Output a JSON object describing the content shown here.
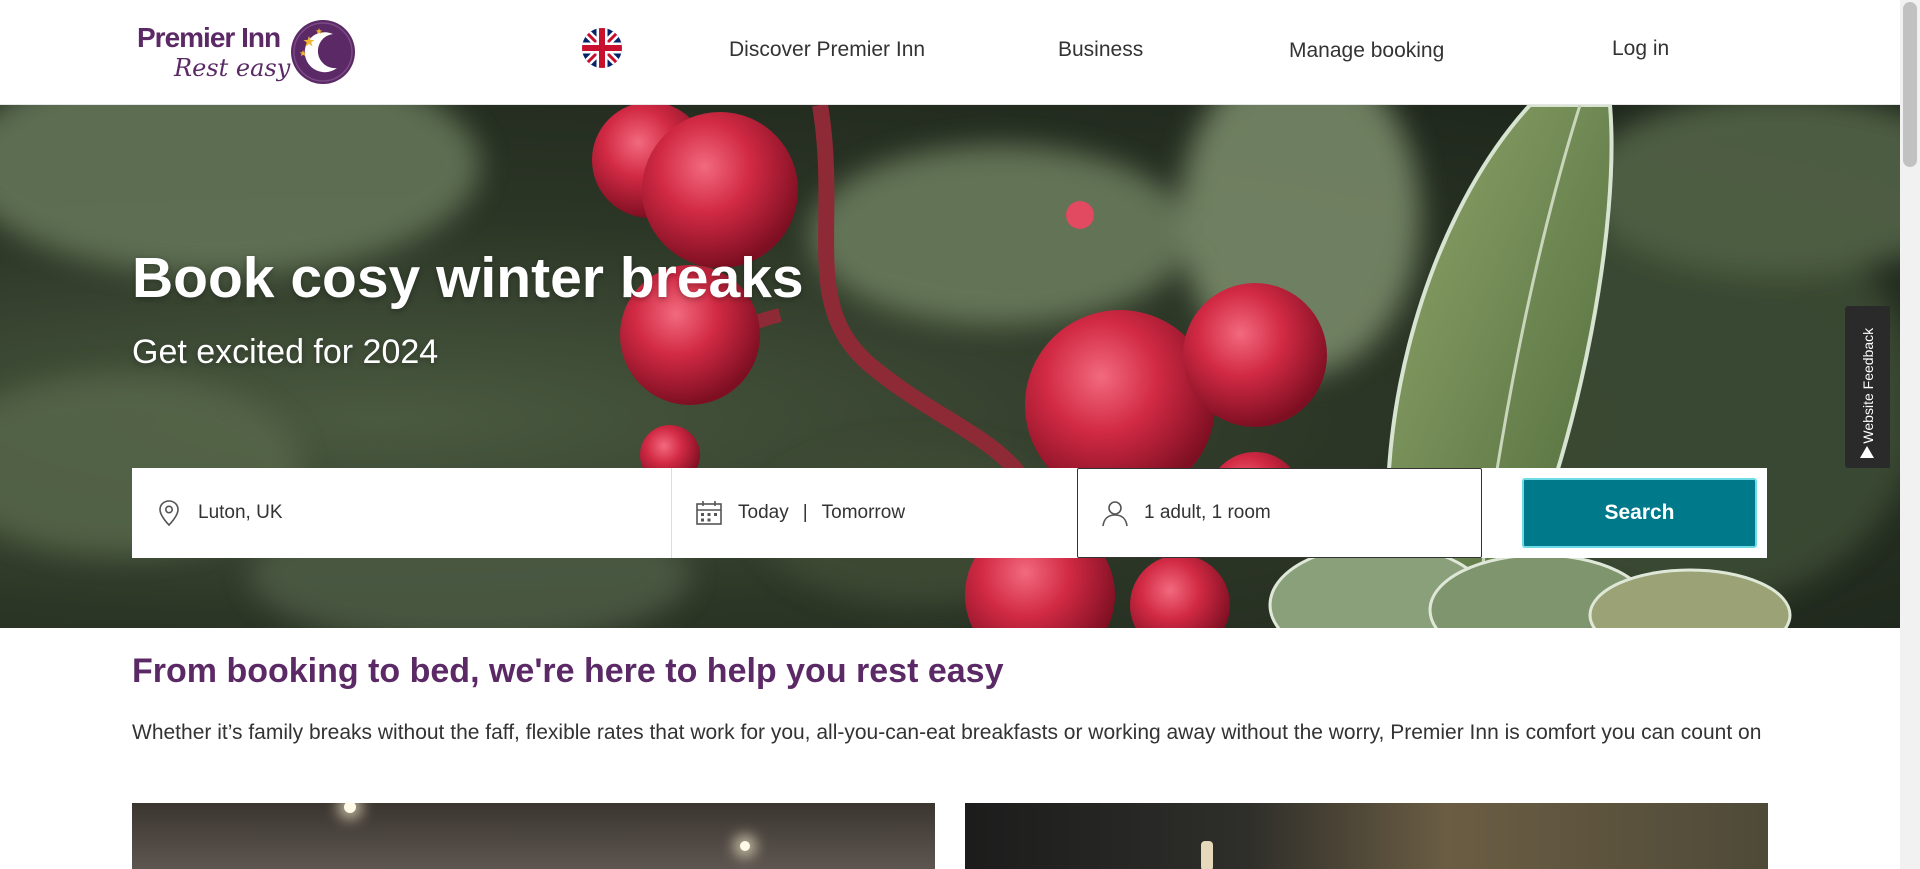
{
  "header": {
    "logo": {
      "line1": "Premier Inn",
      "line2": "Rest easy"
    },
    "nav": [
      {
        "label": "Discover Premier Inn"
      },
      {
        "label": "Business"
      },
      {
        "label": "Manage booking"
      },
      {
        "label": "Log in"
      }
    ]
  },
  "hero": {
    "title": "Book cosy winter breaks",
    "subtitle": "Get excited for 2024"
  },
  "search": {
    "location": "Luton, UK",
    "check_in": "Today",
    "date_separator": "|",
    "check_out": "Tomorrow",
    "guests": "1 adult, 1 room",
    "button_label": "Search"
  },
  "feedback": {
    "label": "Website Feedback"
  },
  "content": {
    "heading": "From booking to bed, we're here to help you rest easy",
    "body": "Whether it’s family breaks without the faff, flexible rates that work for you, all-you-can-eat breakfasts or working away without the worry, Premier Inn is comfort you can count on"
  },
  "colors": {
    "brand_purple": "#5b2a66",
    "search_button": "#007a8a",
    "berry_red": "#c8243c"
  },
  "icons": {
    "location": "location-pin-icon",
    "dates": "calendar-icon",
    "guests": "person-icon",
    "language": "uk-flag-icon",
    "feedback": "arrow-up-icon"
  }
}
